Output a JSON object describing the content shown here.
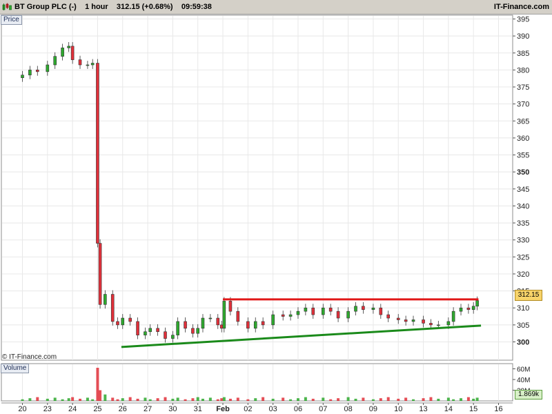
{
  "header": {
    "instrument": "BT Group PLC (-)",
    "timeframe": "1 hour",
    "last": "312.15",
    "change": "(+0.68%)",
    "time": "09:59:38",
    "brand": "IT-Finance.com"
  },
  "price_pane_label": "Price",
  "volume_pane_label": "Volume",
  "copyright": "© IT-Finance.com",
  "last_price_badge": "312.15",
  "last_volume_badge": "1.869k",
  "colors": {
    "up": "#2ea82e",
    "down": "#e0303a",
    "resistance": "#e01818",
    "support": "#1a8a1a",
    "grid": "#e8e8e8",
    "frame": "#8c8c8c"
  },
  "chart_data": {
    "type": "candlestick",
    "title": "",
    "y_axis": {
      "ticks": [
        "395",
        "390",
        "385",
        "380",
        "375",
        "370",
        "365",
        "360",
        "355",
        "350",
        "345",
        "340",
        "335",
        "330",
        "325",
        "320",
        "315",
        "310",
        "305",
        "300"
      ],
      "bold_ticks": [
        "350",
        "300"
      ],
      "range": [
        295,
        397
      ]
    },
    "volume_axis": {
      "ticks": [
        "60M",
        "40M",
        "20M"
      ],
      "range": [
        0,
        80
      ]
    },
    "x_axis": {
      "ticks": [
        "20",
        "23",
        "24",
        "25",
        "26",
        "27",
        "30",
        "31",
        "Feb",
        "02",
        "03",
        "06",
        "07",
        "08",
        "09",
        "10",
        "13",
        "14",
        "15",
        "16"
      ],
      "bold_ticks": [
        "Feb"
      ]
    },
    "close_series": [
      {
        "t": 0.0,
        "v": 378.5
      },
      {
        "t": 0.3,
        "v": 380.0
      },
      {
        "t": 0.6,
        "v": 379.5
      },
      {
        "t": 1.0,
        "v": 381.5
      },
      {
        "t": 1.3,
        "v": 384.0
      },
      {
        "t": 1.6,
        "v": 386.5
      },
      {
        "t": 1.85,
        "v": 387.0
      },
      {
        "t": 2.0,
        "v": 383.0
      },
      {
        "t": 2.3,
        "v": 381.5
      },
      {
        "t": 2.6,
        "v": 381.5
      },
      {
        "t": 2.8,
        "v": 382.0
      },
      {
        "t": 3.0,
        "v": 329.0
      },
      {
        "t": 3.1,
        "v": 311.0
      },
      {
        "t": 3.3,
        "v": 314.0
      },
      {
        "t": 3.6,
        "v": 306.0
      },
      {
        "t": 3.8,
        "v": 305.0
      },
      {
        "t": 4.0,
        "v": 307.0
      },
      {
        "t": 4.3,
        "v": 306.0
      },
      {
        "t": 4.6,
        "v": 302.0
      },
      {
        "t": 4.9,
        "v": 303.0
      },
      {
        "t": 5.1,
        "v": 304.0
      },
      {
        "t": 5.4,
        "v": 303.0
      },
      {
        "t": 5.7,
        "v": 301.0
      },
      {
        "t": 6.0,
        "v": 302.0
      },
      {
        "t": 6.2,
        "v": 306.0
      },
      {
        "t": 6.5,
        "v": 304.0
      },
      {
        "t": 6.8,
        "v": 302.5
      },
      {
        "t": 7.0,
        "v": 304.0
      },
      {
        "t": 7.2,
        "v": 307.0
      },
      {
        "t": 7.5,
        "v": 307.0
      },
      {
        "t": 7.8,
        "v": 305.0
      },
      {
        "t": 7.95,
        "v": 304.0
      },
      {
        "t": 8.05,
        "v": 312.0
      },
      {
        "t": 8.3,
        "v": 309.0
      },
      {
        "t": 8.6,
        "v": 306.0
      },
      {
        "t": 9.0,
        "v": 304.0
      },
      {
        "t": 9.3,
        "v": 306.0
      },
      {
        "t": 9.6,
        "v": 305.0
      },
      {
        "t": 10.0,
        "v": 308.0
      },
      {
        "t": 10.4,
        "v": 307.5
      },
      {
        "t": 10.7,
        "v": 308.0
      },
      {
        "t": 11.0,
        "v": 309.0
      },
      {
        "t": 11.3,
        "v": 310.0
      },
      {
        "t": 11.6,
        "v": 308.0
      },
      {
        "t": 12.0,
        "v": 310.0
      },
      {
        "t": 12.3,
        "v": 309.0
      },
      {
        "t": 12.6,
        "v": 307.0
      },
      {
        "t": 13.0,
        "v": 309.0
      },
      {
        "t": 13.3,
        "v": 310.5
      },
      {
        "t": 13.6,
        "v": 309.5
      },
      {
        "t": 14.0,
        "v": 310.0
      },
      {
        "t": 14.3,
        "v": 308.0
      },
      {
        "t": 14.6,
        "v": 307.0
      },
      {
        "t": 15.0,
        "v": 306.5
      },
      {
        "t": 15.3,
        "v": 306.0
      },
      {
        "t": 15.6,
        "v": 306.5
      },
      {
        "t": 16.0,
        "v": 305.5
      },
      {
        "t": 16.3,
        "v": 305.0
      },
      {
        "t": 16.6,
        "v": 305.0
      },
      {
        "t": 17.0,
        "v": 306.0
      },
      {
        "t": 17.2,
        "v": 309.0
      },
      {
        "t": 17.5,
        "v": 310.0
      },
      {
        "t": 17.8,
        "v": 309.5
      },
      {
        "t": 18.0,
        "v": 310.5
      },
      {
        "t": 18.15,
        "v": 312.15
      }
    ],
    "spike_volume": [
      {
        "t": 3.0,
        "v": 62
      },
      {
        "t": 3.1,
        "v": 20
      },
      {
        "t": 3.3,
        "v": 12
      }
    ],
    "annotations": {
      "resistance": {
        "t1": 8.0,
        "v1": 312.5,
        "t2": 18.2,
        "v2": 312.5
      },
      "support": {
        "t1": 3.95,
        "v1": 298.5,
        "t2": 18.3,
        "v2": 304.8
      }
    }
  }
}
